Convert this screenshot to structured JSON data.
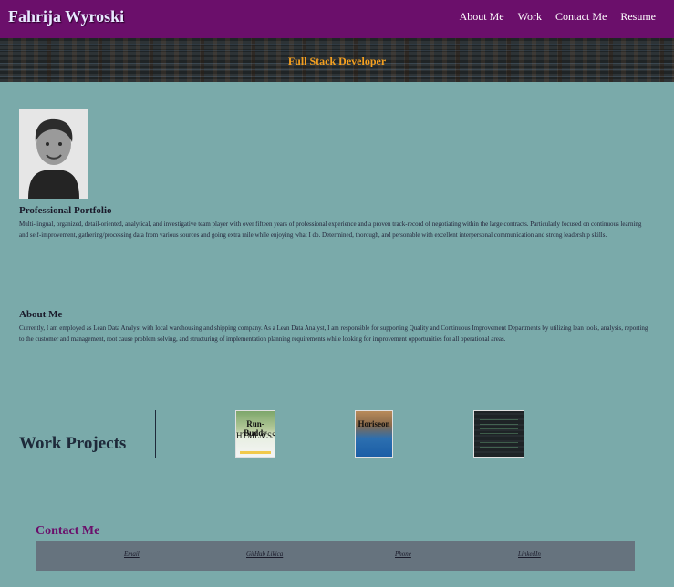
{
  "header": {
    "brand": "Fahrija Wyroski",
    "nav": [
      "About Me",
      "Work",
      "Contact Me",
      "Resume"
    ]
  },
  "banner": {
    "tagline": "Full Stack Developer"
  },
  "portfolio": {
    "title": "Professional Portfolio",
    "text": "Multi-lingual, organized, detail-oriented, analytical, and investigative team player with over fifteen years of professional experience and a proven track-record of negotiating within the large contracts. Particularly focused on continuous learning and self-improvement, gathering/processing data from various sources and going extra mile while enjoying what I do. Determined, thorough, and personable with excellent interpersonal communication and strong leadership skills."
  },
  "about": {
    "title": "About Me",
    "text": "Currently, I am employed as Lean Data Analyst with local warehousing and shipping company. As a Lean Data Analyst, I am responsible for supporting Quality and Continuous Improvement Departments by utilizing lean tools, analysis, reporting to the customer and management, root cause problem solving, and structuring of implementation planning requirements while looking for improvement opportunities for all operational areas."
  },
  "work": {
    "title": "Work Projects",
    "projects": [
      {
        "line1": "Run-Buddy",
        "line2": "HTML/CSS"
      },
      {
        "line1": "Horiseon",
        "line2": ""
      },
      {
        "line1": "",
        "line2": ""
      }
    ]
  },
  "contact": {
    "title": "Contact Me",
    "links": [
      "Email",
      "GitHub Likica",
      "Phone",
      "LinkedIn"
    ]
  },
  "colors": {
    "background": "#7aaaaa",
    "header": "#6b0f6b",
    "tagline": "#f4a020",
    "contact_bar": "#66737e"
  }
}
